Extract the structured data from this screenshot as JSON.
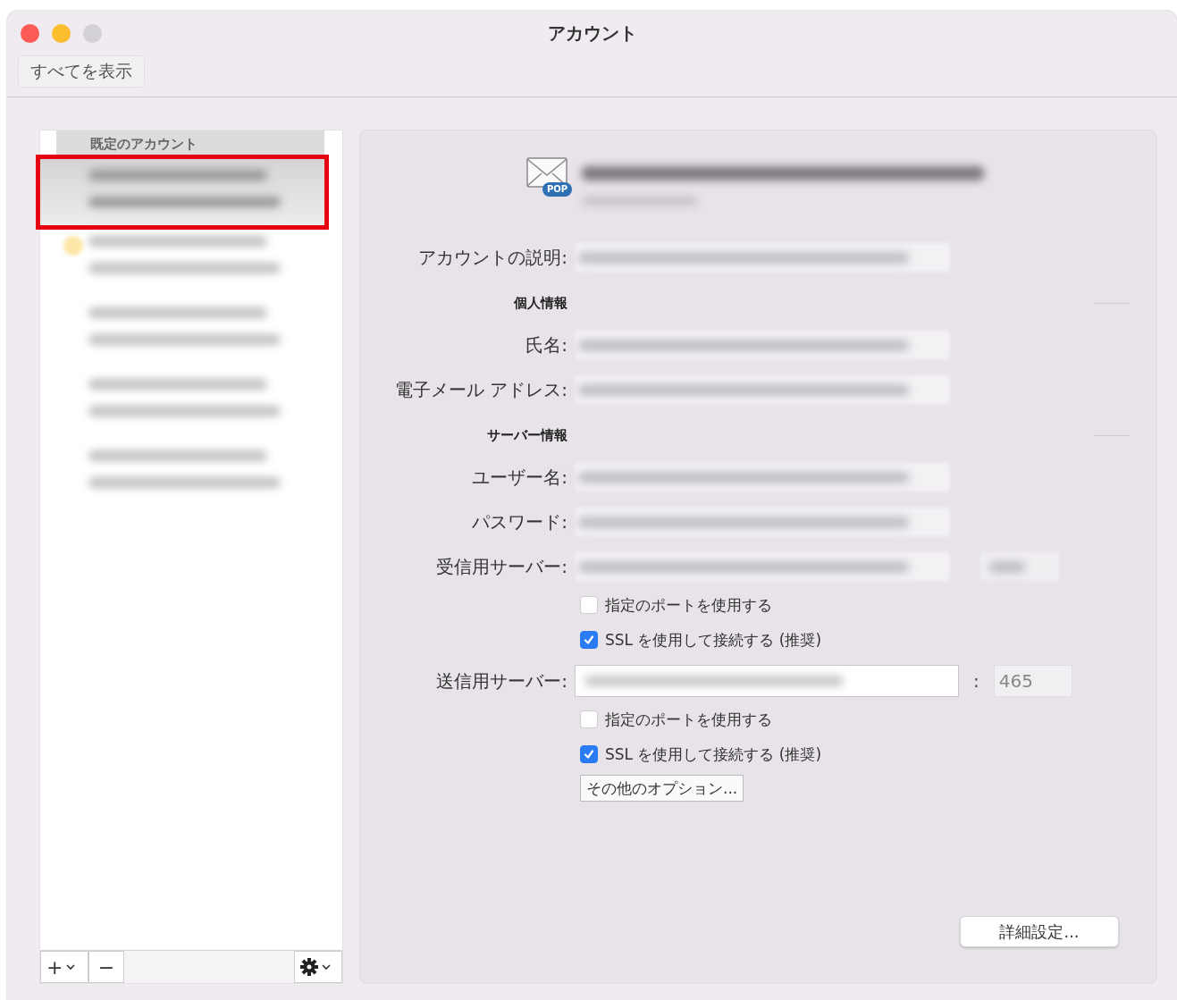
{
  "window": {
    "title": "アカウント",
    "toolbar_button": "すべてを表示"
  },
  "sidebar": {
    "header": "既定のアカウント",
    "accounts": [
      {
        "selected": true,
        "highlighted": true,
        "marked": false
      },
      {
        "selected": false,
        "highlighted": false,
        "marked": true
      },
      {
        "selected": false,
        "highlighted": false,
        "marked": false
      },
      {
        "selected": false,
        "highlighted": false,
        "marked": false
      },
      {
        "selected": false,
        "highlighted": false,
        "marked": false
      }
    ],
    "bottom_bar": {
      "add": "+",
      "remove": "−"
    }
  },
  "form": [
    {
      "kind": "field",
      "label": "アカウントの説明:"
    },
    {
      "kind": "section",
      "label": "個人情報"
    },
    {
      "kind": "field",
      "label": "氏名:"
    },
    {
      "kind": "field",
      "label": "電子メール アドレス:"
    },
    {
      "kind": "section",
      "label": "サーバー情報"
    },
    {
      "kind": "field",
      "label": "ユーザー名:"
    },
    {
      "kind": "field",
      "label": "パスワード:"
    },
    {
      "kind": "server",
      "label": "受信用サーバー:"
    },
    {
      "kind": "checkbox",
      "label": "指定のポートを使用する",
      "checked": false
    },
    {
      "kind": "checkbox",
      "label": "SSL を使用して接続する (推奨)",
      "checked": true
    },
    {
      "kind": "server",
      "label": "送信用サーバー:",
      "separator": ":",
      "port": "465"
    },
    {
      "kind": "checkbox",
      "label": "指定のポートを使用する",
      "checked": false
    },
    {
      "kind": "checkbox",
      "label": "SSL を使用して接続する (推奨)",
      "checked": true
    },
    {
      "kind": "button",
      "label": "その他のオプション..."
    }
  ],
  "account_type_badge": "POP",
  "advanced_button": "詳細設定..."
}
